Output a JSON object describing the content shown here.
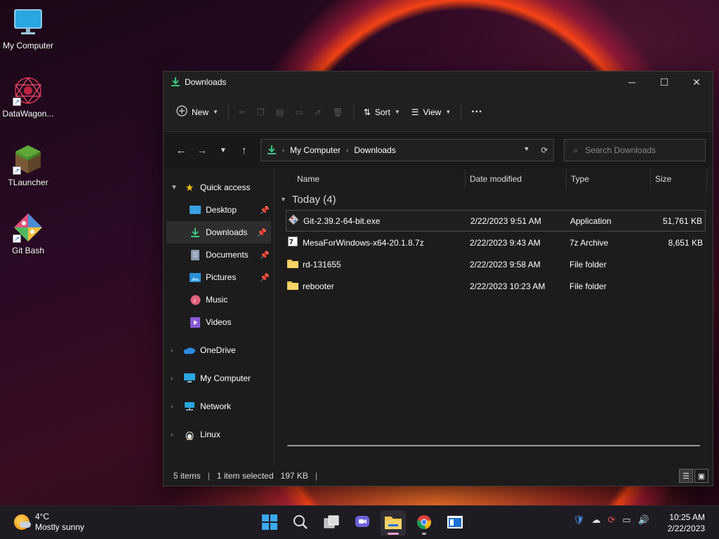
{
  "desktop": {
    "icons": [
      {
        "label": "My Computer",
        "icon": "monitor-icon"
      },
      {
        "label": "DataWagon...",
        "icon": "datawagon-icon"
      },
      {
        "label": "TLauncher",
        "icon": "grass-block-icon"
      },
      {
        "label": "Git Bash",
        "icon": "git-icon"
      }
    ]
  },
  "window": {
    "title": "Downloads",
    "controls": {
      "minimize": "─",
      "maximize": "☐",
      "close": "✕"
    }
  },
  "commandbar": {
    "new_label": "New",
    "sort_label": "Sort",
    "view_label": "View",
    "more_label": "···"
  },
  "address": {
    "crumbs": [
      "My Computer",
      "Downloads"
    ],
    "search_placeholder": "Search Downloads"
  },
  "navpane": {
    "items": [
      {
        "label": "Quick access",
        "icon": "star-icon"
      },
      {
        "label": "Desktop",
        "icon": "desktop-icon"
      },
      {
        "label": "Downloads",
        "icon": "download-icon"
      },
      {
        "label": "Documents",
        "icon": "documents-icon"
      },
      {
        "label": "Pictures",
        "icon": "pictures-icon"
      },
      {
        "label": "Music",
        "icon": "music-icon"
      },
      {
        "label": "Videos",
        "icon": "videos-icon"
      },
      {
        "label": "OneDrive",
        "icon": "cloud-icon"
      },
      {
        "label": "My Computer",
        "icon": "monitor-icon"
      },
      {
        "label": "Network",
        "icon": "network-icon"
      },
      {
        "label": "Linux",
        "icon": "linux-icon"
      }
    ]
  },
  "columns": {
    "name": "Name",
    "date": "Date modified",
    "type": "Type",
    "size": "Size"
  },
  "group": {
    "label": "Today (4)"
  },
  "files": [
    {
      "name": "Git-2.39.2-64-bit.exe",
      "date": "2/22/2023 9:51 AM",
      "type": "Application",
      "size": "51,761 KB"
    },
    {
      "name": "MesaForWindows-x64-20.1.8.7z",
      "date": "2/22/2023 9:43 AM",
      "type": "7z Archive",
      "size": "8,651 KB"
    },
    {
      "name": "rd-131655",
      "date": "2/22/2023 9:58 AM",
      "type": "File folder",
      "size": ""
    },
    {
      "name": "rebooter",
      "date": "2/22/2023 10:23 AM",
      "type": "File folder",
      "size": ""
    }
  ],
  "status": {
    "items": "5 items",
    "selected": "1 item selected",
    "size": "197 KB"
  },
  "taskbar": {
    "weather_temp": "4°C",
    "weather_desc": "Mostly sunny",
    "time": "10:25 AM",
    "date": "2/22/2023"
  }
}
